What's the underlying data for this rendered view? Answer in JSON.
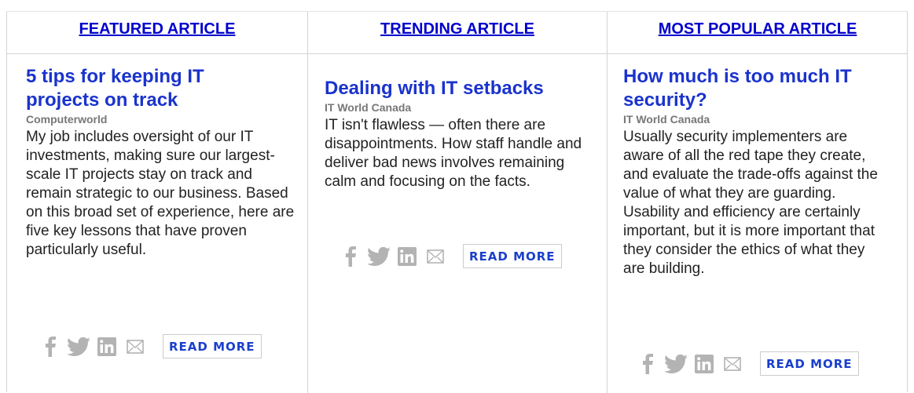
{
  "colors": {
    "header_link": "#0000cc",
    "title_link": "#1a33cc",
    "source_text": "#777777",
    "icon_gray": "#b3b3b3",
    "button_text": "#1a3fcc"
  },
  "columns": [
    {
      "header": "FEATURED ARTICLE",
      "title": "5 tips for keeping IT projects on track",
      "source": "Computerworld",
      "summary": "My job includes oversight of our IT investments, making sure our largest-scale IT projects stay on track and remain strategic to our business. Based on this broad set of experience, here are five key lessons that have proven particularly useful.",
      "read_more": "READ MORE"
    },
    {
      "header": "TRENDING ARTICLE",
      "title": "Dealing with IT setbacks",
      "source": "IT World Canada",
      "summary": "IT isn't flawless — often there are disappointments. How staff handle and deliver bad news involves remaining calm and focusing on the facts.",
      "read_more": "READ MORE"
    },
    {
      "header": "MOST POPULAR ARTICLE",
      "title": "How much is too much IT security?",
      "source": "IT World Canada",
      "summary": "Usually security implementers are aware of all the red tape they create, and evaluate the trade-offs against the value of what they are guarding. Usability and efficiency are certainly important, but it is more important that they consider the ethics of what they are building.",
      "read_more": "READ MORE"
    }
  ],
  "share_icons": [
    "facebook-icon",
    "twitter-icon",
    "linkedin-icon",
    "email-icon"
  ]
}
